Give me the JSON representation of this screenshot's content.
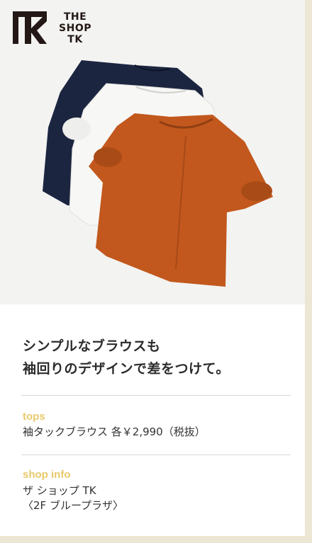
{
  "brand": {
    "logo_mark": "TK",
    "logo_lines": [
      "THE",
      "SHOP",
      "TK"
    ]
  },
  "headline": {
    "line1": "シンプルなブラウスも",
    "line2": "袖回りのデザインで差をつけて。"
  },
  "tops": {
    "label": "tops",
    "text": "袖タックブラウス 各￥2,990（税抜）"
  },
  "shop_info": {
    "label": "shop info",
    "line1": "ザ ショップ TK",
    "line2": "〈2F ブループラザ〉"
  },
  "colors": {
    "accent_label": "#e8c96a",
    "navy_blouse": "#1c2540",
    "white_blouse": "#f7f7f5",
    "orange_blouse": "#c2581d",
    "frame": "#ece6d4"
  },
  "photo": {
    "subject": "three-blouses-navy-white-orange"
  }
}
